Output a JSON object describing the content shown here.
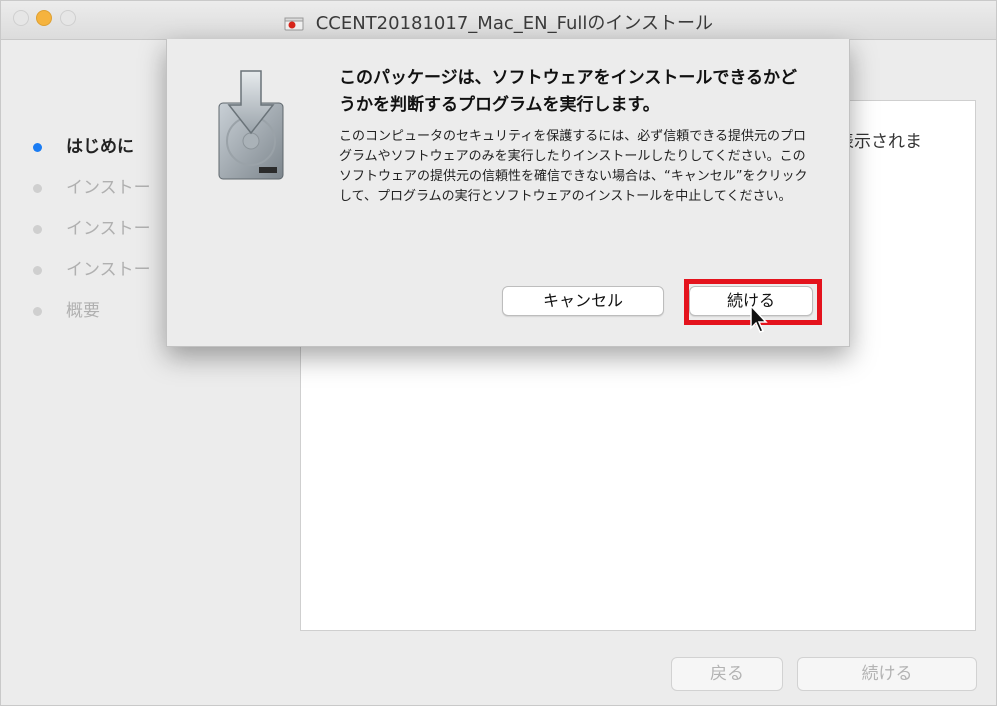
{
  "window": {
    "title": "CCENT20181017_Mac_EN_Fullのインストール"
  },
  "sidebar": {
    "steps": [
      {
        "label": "はじめに",
        "active": true
      },
      {
        "label": "インストー",
        "active": false
      },
      {
        "label": "インストー",
        "active": false
      },
      {
        "label": "インストー",
        "active": false
      },
      {
        "label": "概要",
        "active": false
      }
    ]
  },
  "content": {
    "peek_text": "表示されま"
  },
  "footer": {
    "back_label": "戻る",
    "continue_label": "続ける"
  },
  "dialog": {
    "heading": "このパッケージは、ソフトウェアをインストールできるかどうかを判断するプログラムを実行します。",
    "body": "このコンピュータのセキュリティを保護するには、必ず信頼できる提供元のプログラムやソフトウェアのみを実行したりインストールしたりしてください。このソフトウェアの提供元の信頼性を確信できない場合は、“キャンセル”をクリックして、プログラムの実行とソフトウェアのインストールを中止してください。",
    "cancel_label": "キャンセル",
    "continue_label": "続ける",
    "icon": "installer-disk-icon"
  },
  "colors": {
    "highlight": "#e4131d",
    "active_dot": "#1a7cf3"
  }
}
